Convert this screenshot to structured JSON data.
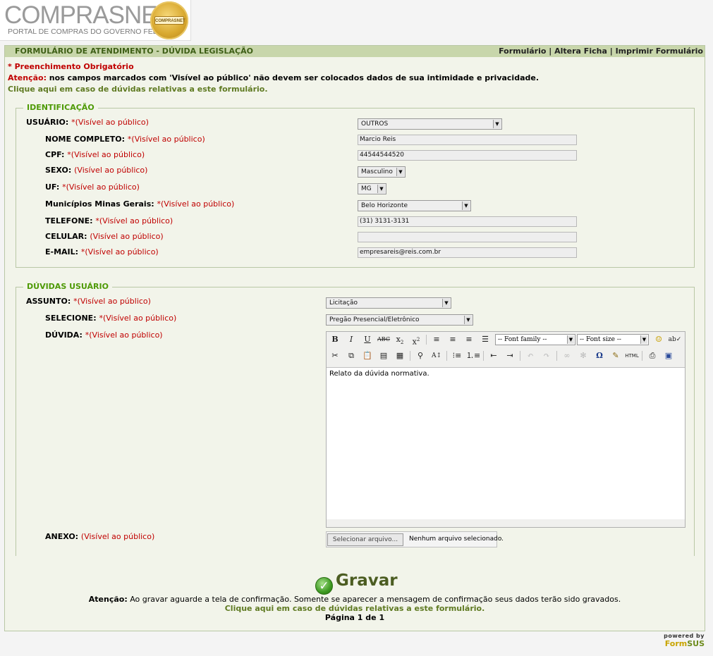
{
  "logo": {
    "brand": "COMPRASNET",
    "subtitle": "PORTAL DE COMPRAS DO GOVERNO FEDERAL",
    "seal": "COMPRASNET"
  },
  "header": {
    "title": "FORMULÁRIO DE ATENDIMENTO - DÚVIDA LEGISLAÇÃO",
    "links": [
      "Formulário",
      "Altera Ficha",
      "Imprimir Formulário"
    ],
    "sep": "|"
  },
  "notices": {
    "required": "* Preenchimento Obrigatório",
    "attention_label": "Atenção:",
    "attention_text": " nos campos marcados com 'Visível ao público' não devem ser colocados dados de sua intimidade e privacidade.",
    "help": "Clique aqui em caso de dúvidas relativas a este formulário."
  },
  "identificacao": {
    "legend": "IDENTIFICAÇÃO",
    "usuario": {
      "label": "USUÁRIO:",
      "pub": "*(Visível ao público)",
      "value": "OUTROS"
    },
    "nome": {
      "label": "NOME COMPLETO:",
      "pub": "*(Visível ao público)",
      "value": "Marcio Reis"
    },
    "cpf": {
      "label": "CPF:",
      "pub": "*(Visível ao público)",
      "value": "44544544520"
    },
    "sexo": {
      "label": "SEXO:",
      "pub": "(Visível ao público)",
      "value": "Masculino"
    },
    "uf": {
      "label": "UF:",
      "pub": "*(Visível ao público)",
      "value": "MG"
    },
    "municipio": {
      "label": "Municípios Minas Gerais:",
      "pub": "*(Visível ao público)",
      "value": "Belo Horizonte"
    },
    "telefone": {
      "label": "TELEFONE:",
      "pub": "*(Visível ao público)",
      "value": "(31) 3131-3131"
    },
    "celular": {
      "label": "CELULAR:",
      "pub": "(Visível ao público)",
      "value": ""
    },
    "email": {
      "label": "E-MAIL:",
      "pub": "*(Visível ao público)",
      "value": "empresareis@reis.com.br"
    }
  },
  "duvidas": {
    "legend": "DÚVIDAS USUÁRIO",
    "assunto": {
      "label": "ASSUNTO:",
      "pub": "*(Visível ao público)",
      "value": "Licitação"
    },
    "selecione": {
      "label": "SELECIONE:",
      "pub": "*(Visível ao público)",
      "value": "Pregão Presencial/Eletrônico"
    },
    "duvida": {
      "label": "DÚVIDA:",
      "pub": "*(Visível ao público)",
      "text": "Relato da dúvida normativa."
    },
    "editor": {
      "font_family": "-- Font family --",
      "font_size": "-- Font size --",
      "html_label": "HTML"
    },
    "anexo": {
      "label": "ANEXO:",
      "pub": "(Visível ao público)",
      "button": "Selecionar arquivo...",
      "status": "Nenhum arquivo selecionado."
    }
  },
  "footer": {
    "save": "Gravar",
    "attention_label": "Atenção:",
    "attention_text": " Ao gravar aguarde a tela de confirmação. Somente se aparecer a mensagem de confirmação seus dados terão sido gravados.",
    "help": "Clique aqui em caso de dúvidas relativas a este formulário.",
    "page": "Página 1 de 1"
  },
  "powered": {
    "line1": "powered by",
    "form": "Form",
    "sus": "SUS"
  }
}
